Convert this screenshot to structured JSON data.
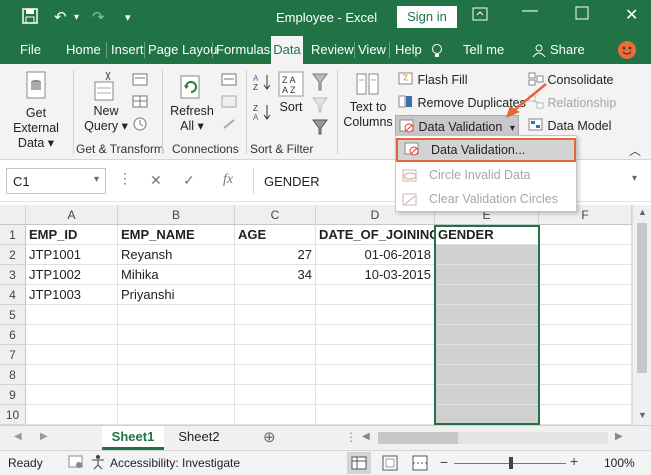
{
  "titlebar": {
    "title": "Employee - Excel",
    "signin_label": "Sign in",
    "colors": {
      "bar": "#217346"
    }
  },
  "tabs": [
    "File",
    "Home",
    "Insert",
    "Page Layou",
    "Formulas",
    "Data",
    "Review",
    "View",
    "Help",
    "Tell me",
    "Share"
  ],
  "active_tab": "Data",
  "ribbon": {
    "get_external_data": {
      "line1": "Get External",
      "line2": "Data"
    },
    "new_query": {
      "line1": "New",
      "line2": "Query"
    },
    "refresh_all": {
      "line1": "Refresh",
      "line2": "All"
    },
    "sort": "Sort",
    "text_to_columns": {
      "line1": "Text to",
      "line2": "Columns"
    },
    "flash_fill": "Flash Fill",
    "remove_duplicates": "Remove Duplicates",
    "data_validation": "Data Validation",
    "consolidate": "Consolidate",
    "relationships": "Relationship",
    "data_model": "Data Model",
    "groups": [
      "Get & Transform",
      "Connections",
      "Sort & Filter"
    ]
  },
  "dropdown": {
    "items": [
      "Data Validation...",
      "Circle Invalid Data",
      "Clear Validation Circles"
    ],
    "highlight_color": "#e2673a"
  },
  "formula_bar": {
    "name_box": "C1",
    "fx": "fx",
    "content": "GENDER"
  },
  "columns": [
    "A",
    "B",
    "C",
    "D",
    "E",
    "F"
  ],
  "rows": [
    [
      "EMP_ID",
      "EMP_NAME",
      "AGE",
      "DATE_OF_JOINING",
      "GENDER",
      ""
    ],
    [
      "JTP1001",
      "Reyansh",
      "27",
      "01-06-2018",
      "",
      ""
    ],
    [
      "JTP1002",
      "Mihika",
      "34",
      "10-03-2015",
      "",
      ""
    ],
    [
      "JTP1003",
      "Priyanshi",
      "",
      "",
      "",
      ""
    ],
    [
      "",
      "",
      "",
      "",
      "",
      ""
    ],
    [
      "",
      "",
      "",
      "",
      "",
      ""
    ],
    [
      "",
      "",
      "",
      "",
      "",
      ""
    ],
    [
      "",
      "",
      "",
      "",
      "",
      ""
    ],
    [
      "",
      "",
      "",
      "",
      "",
      ""
    ],
    [
      "",
      "",
      "",
      "",
      "",
      ""
    ]
  ],
  "row_numbers": [
    "1",
    "2",
    "3",
    "4",
    "5",
    "6",
    "7",
    "8",
    "9",
    "10"
  ],
  "sheets": [
    "Sheet1",
    "Sheet2"
  ],
  "active_sheet": "Sheet1",
  "status": {
    "ready": "Ready",
    "accessibility": "Accessibility: Investigate",
    "zoom": "100%"
  }
}
